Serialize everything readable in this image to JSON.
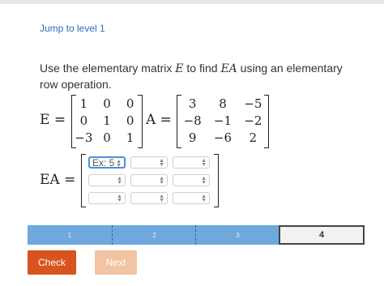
{
  "header": {
    "jump_label": "Jump to level 1"
  },
  "question": {
    "prefix": "Use the elementary matrix ",
    "var_e": "E",
    "mid": " to find ",
    "var_ea": "EA",
    "suffix": " using an elementary row operation."
  },
  "matrix_e": {
    "label": "E =",
    "rows": [
      [
        "1",
        "0",
        "0"
      ],
      [
        "0",
        "1",
        "0"
      ],
      [
        "−3",
        "0",
        "1"
      ]
    ]
  },
  "matrix_a": {
    "label": "A =",
    "rows": [
      [
        "3",
        "8",
        "−5"
      ],
      [
        "−8",
        "−1",
        "−2"
      ],
      [
        "9",
        "−6",
        "2"
      ]
    ]
  },
  "answer": {
    "label": "EA =",
    "placeholder": "Ex: 5",
    "rows": [
      [
        "",
        "",
        ""
      ],
      [
        "",
        "",
        ""
      ],
      [
        "",
        "",
        ""
      ]
    ]
  },
  "progress": {
    "levels": [
      "1",
      "2",
      "3",
      "4"
    ],
    "current_level": "4"
  },
  "buttons": {
    "check_label": "Check",
    "next_label": "Next"
  },
  "colors": {
    "link": "#2a6ebb",
    "check_button": "#d9531e",
    "next_button_disabled": "#f2c4a3",
    "progress_fill": "#6fa8dc",
    "input_focus": "#4a90d9"
  }
}
